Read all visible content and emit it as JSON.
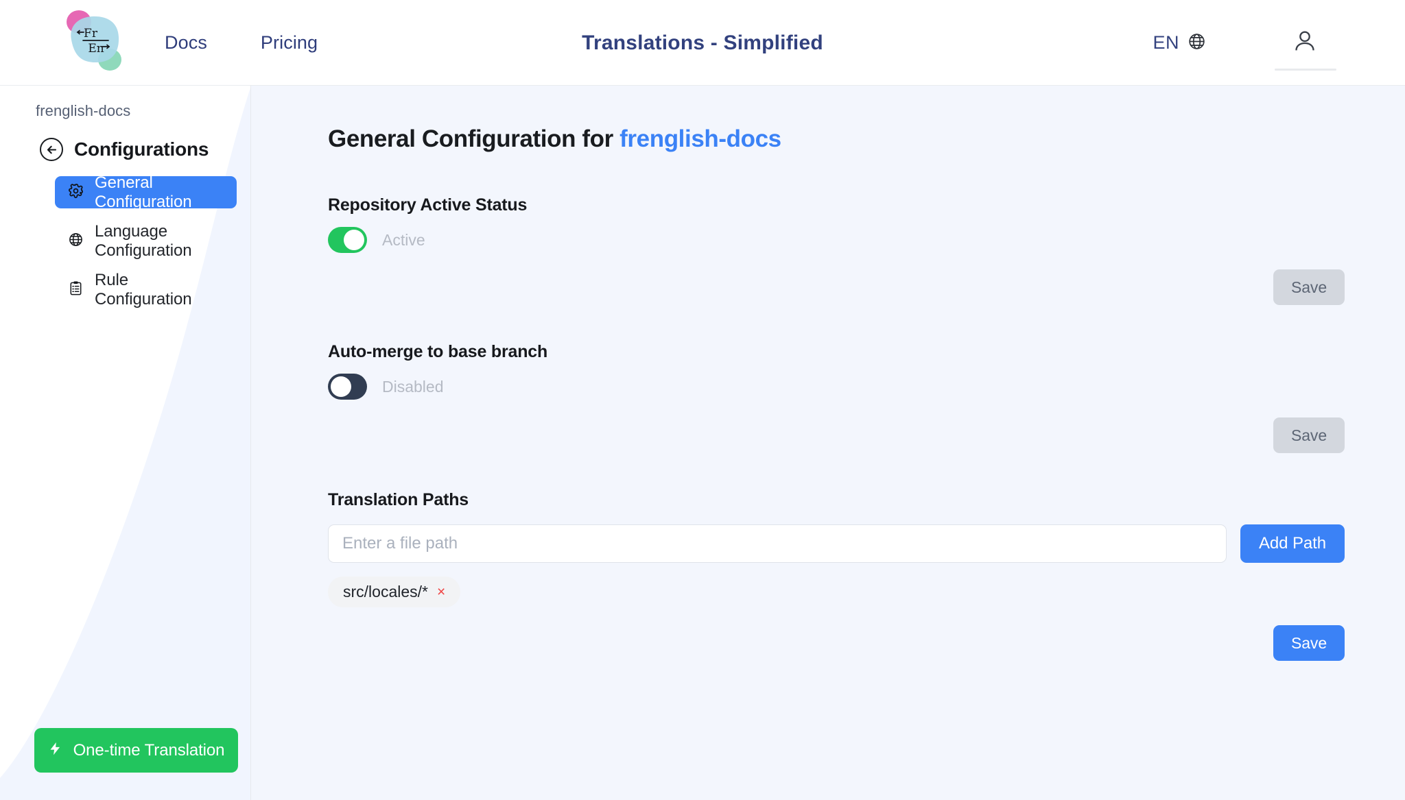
{
  "topnav": {
    "logo": {
      "icon": "frenglish-logo-icon",
      "source_lang": "Fr",
      "target_lang": "En"
    },
    "links": [
      {
        "label": "Docs",
        "name": "nav-link-docs"
      },
      {
        "label": "Pricing",
        "name": "nav-link-pricing"
      }
    ],
    "brand_title": "Translations - Simplified",
    "language": {
      "code": "EN",
      "icon": "globe-icon"
    },
    "account": {
      "icon": "user-account-icon"
    }
  },
  "sidebar": {
    "breadcrumb": "frenglish-docs",
    "back_icon": "back-arrow-icon",
    "heading": "Configurations",
    "items": [
      {
        "label": "General Configuration",
        "icon": "gear-icon",
        "glyph": "⚙",
        "active": true
      },
      {
        "label": "Language Configuration",
        "icon": "globe-icon",
        "glyph": "⊕",
        "active": false
      },
      {
        "label": "Rule Configuration",
        "icon": "clipboard-list-icon",
        "glyph": "ὌB",
        "active": false
      }
    ],
    "one_time_button": {
      "label": "One-time Translation",
      "icon": "lightning-bolt-icon",
      "glyph": "⚡"
    }
  },
  "main": {
    "title_prefix": "General Configuration for ",
    "title_repo": "frenglish-docs",
    "sections": {
      "repo_status": {
        "label": "Repository Active Status",
        "toggle_state": "on",
        "toggle_label": "Active",
        "save_label": "Save",
        "save_enabled": false
      },
      "auto_merge": {
        "label": "Auto-merge to base branch",
        "toggle_state": "off",
        "toggle_label": "Disabled",
        "save_label": "Save",
        "save_enabled": false
      },
      "translation_paths": {
        "label": "Translation Paths",
        "input_value": "",
        "input_placeholder": "Enter a file path",
        "add_button_label": "Add Path",
        "tags": [
          {
            "label": "src/locales/*",
            "remove_glyph": "×"
          }
        ],
        "save_label": "Save",
        "save_enabled": true
      }
    }
  },
  "colors": {
    "accent_blue": "#3b82f6",
    "brand_navy": "#32417e",
    "success_green": "#22c55e",
    "toggle_off": "#313d52",
    "danger_red": "#ef4444",
    "main_bg": "#f3f6fd",
    "sidebar_deco": "#f1f5fe"
  }
}
